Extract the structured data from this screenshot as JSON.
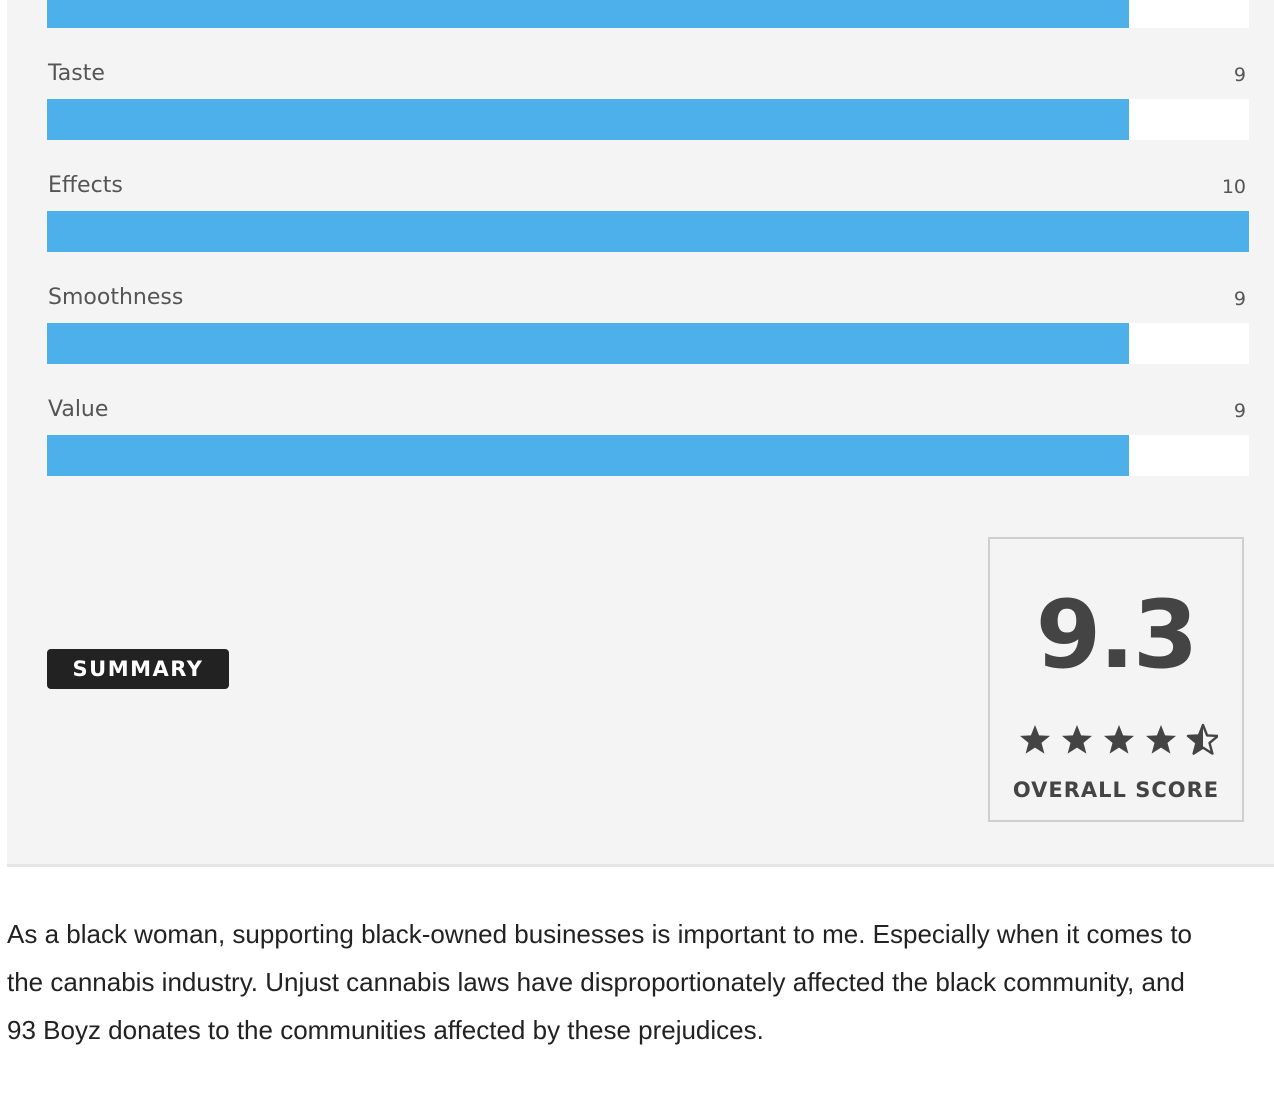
{
  "criteria": [
    {
      "label": "",
      "score": "",
      "fill_fraction": 0.9
    },
    {
      "label": "Taste",
      "score": "9",
      "fill_fraction": 0.9
    },
    {
      "label": "Effects",
      "score": "10",
      "fill_fraction": 1.0
    },
    {
      "label": "Smoothness",
      "score": "9",
      "fill_fraction": 0.9
    },
    {
      "label": "Value",
      "score": "9",
      "fill_fraction": 0.9
    }
  ],
  "summary": {
    "label": "SUMMARY"
  },
  "overall": {
    "score": "9.3",
    "caption": "OVERALL SCORE",
    "stars": 4.5,
    "star_color": "#444444"
  },
  "colors": {
    "bar_fill": "#4db0ea",
    "bar_track": "#ffffff",
    "panel_bg": "#f4f4f4"
  },
  "article": {
    "lines": [
      "As a black woman, supporting black-owned businesses is important to me. Especially when it comes to",
      "the cannabis industry. Unjust cannabis laws have disproportionately affected the black community, and",
      "93 Boyz donates to the communities affected by these prejudices."
    ]
  }
}
